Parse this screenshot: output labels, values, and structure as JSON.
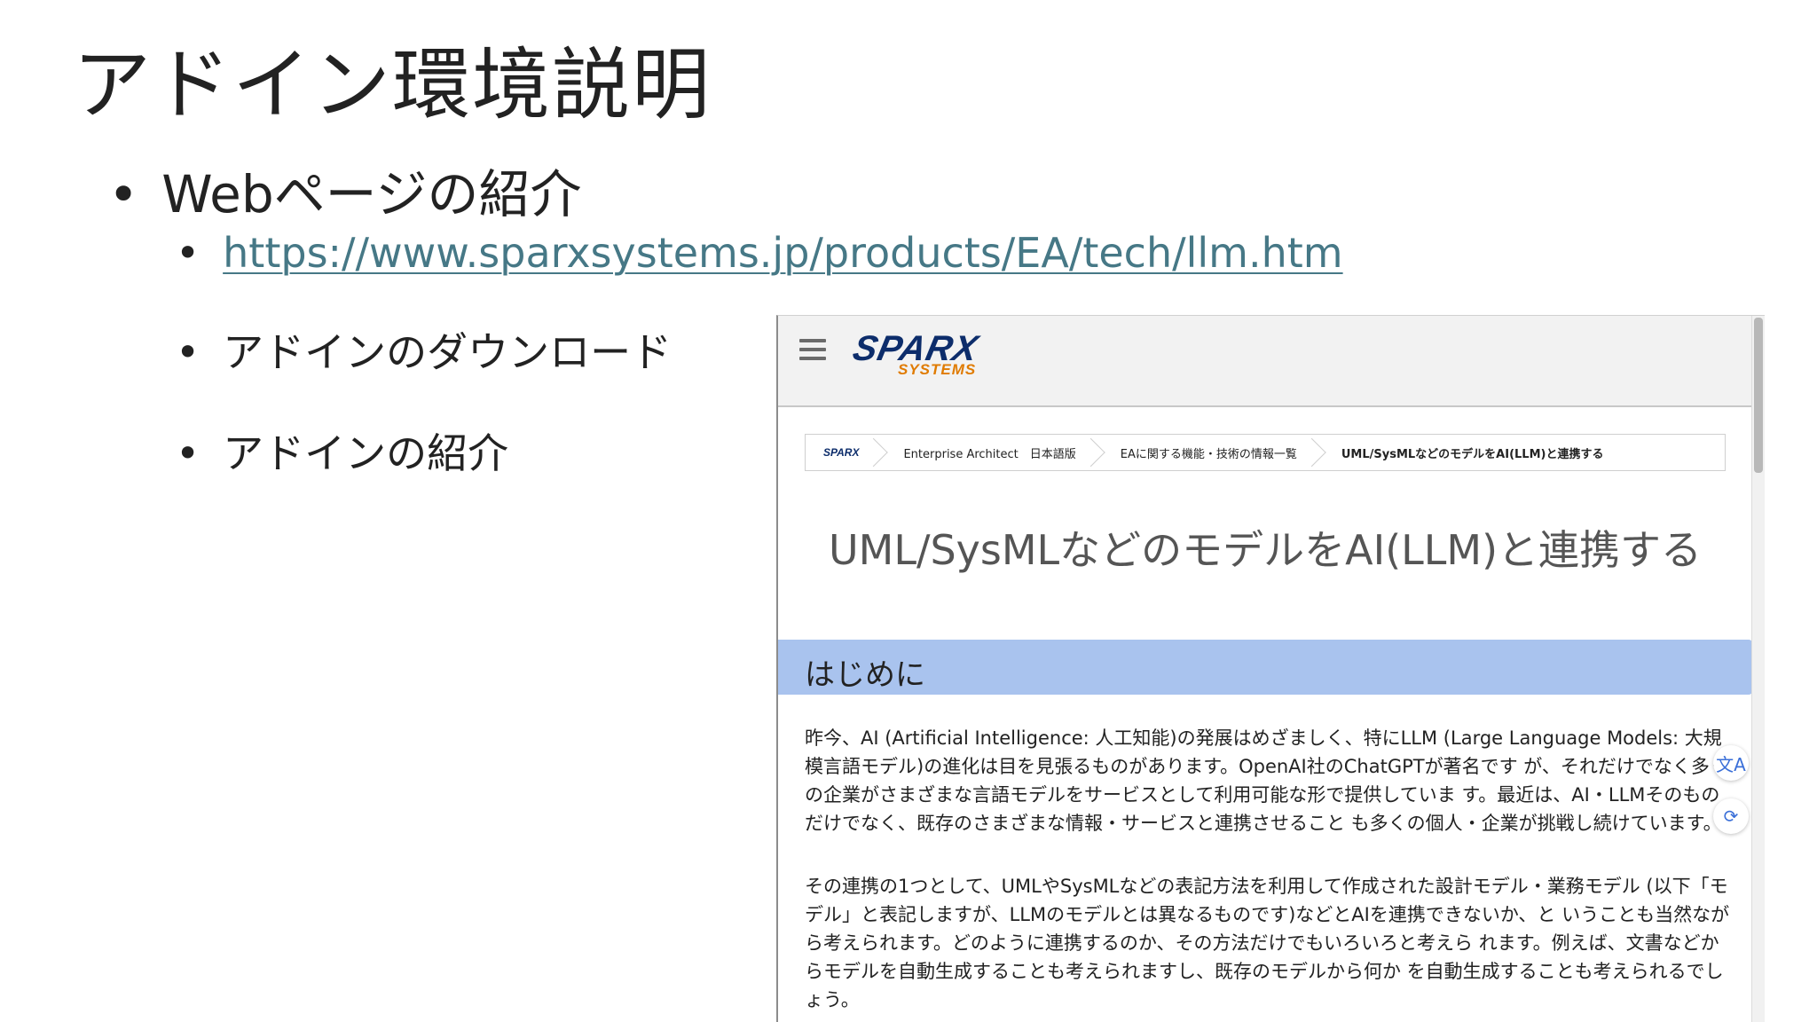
{
  "slide": {
    "title": "アドイン環境説明",
    "bullet_main": "Webページの紹介",
    "link": "https://www.sparxsystems.jp/products/EA/tech/llm.htm",
    "bullet_download": "アドインのダウンロード",
    "bullet_intro": "アドインの紹介",
    "bullet_symbol": "•"
  },
  "webpage": {
    "logo_main": "SPARX",
    "logo_sub": "SYSTEMS",
    "breadcrumb": [
      "SPARX",
      "Enterprise Architect　日本語版",
      "EAに関する機能・技術の情報一覧",
      "UML/SysMLなどのモデルをAI(LLM)と連携する"
    ],
    "heading": "UML/SysMLなどのモデルをAI(LLM)と連携する",
    "section_title": "はじめに",
    "paragraph1": "昨今、AI (Artificial Intelligence: 人工知能)の発展はめざましく、特にLLM (Large Language Models: 大規模言語モデル)の進化は目を見張るものがあります。OpenAI社のChatGPTが著名です が、それだけでなく多くの企業がさまざまな言語モデルをサービスとして利用可能な形で提供していま す。最近は、AI・LLMそのものだけでなく、既存のさまざまな情報・サービスと連携させること も多くの個人・企業が挑戦し続けています。",
    "paragraph2": "その連携の1つとして、UMLやSysMLなどの表記方法を利用して作成された設計モデル・業務モデル (以下「モデル」と表記しますが、LLMのモデルとは異なるものです)などとAIを連携できないか、と いうことも当然ながら考えられます。どのように連携するのか、その方法だけでもいろいろと考えら れます。例えば、文書などからモデルを自動生成することも考えられますし、既存のモデルから何か を自動生成することも考えられるでしょう。",
    "translate_icon": "文A",
    "assist_icon": "⟳"
  }
}
